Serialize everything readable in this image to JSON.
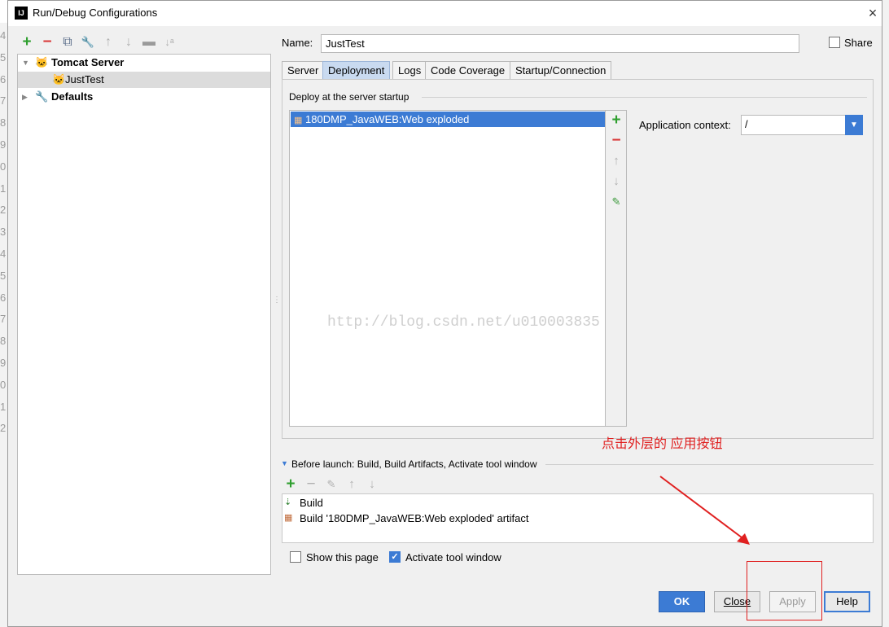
{
  "window": {
    "title": "Run/Debug Configurations",
    "close_glyph": "×"
  },
  "toolbar": {
    "icons": [
      {
        "name": "add-icon",
        "glyph": "+",
        "color": "#2f9f2f"
      },
      {
        "name": "remove-icon",
        "glyph": "−",
        "color": "#d93a3a"
      },
      {
        "name": "copy-icon",
        "glyph": "⧉",
        "color": "#5a6d8a"
      },
      {
        "name": "edit-defaults-icon",
        "glyph": "🔧",
        "color": "#8a6a3a"
      },
      {
        "name": "move-up-icon",
        "glyph": "↑",
        "color": "#b0b0b0"
      },
      {
        "name": "move-down-icon",
        "glyph": "↓",
        "color": "#b0b0b0"
      },
      {
        "name": "folder-icon",
        "glyph": "▬",
        "color": "#9a9a9a"
      },
      {
        "name": "sort-icon",
        "glyph": "↓ᵃ",
        "color": "#b0b0b0"
      }
    ]
  },
  "tree": {
    "items": [
      {
        "label": "Tomcat Server",
        "bold": true,
        "arrow": "▼"
      },
      {
        "label": "JustTest",
        "bold": false,
        "selected": true
      },
      {
        "label": "Defaults",
        "bold": true,
        "arrow": "▶"
      }
    ]
  },
  "form": {
    "name_label": "Name:",
    "name_value": "JustTest",
    "share_label": "Share"
  },
  "tabs": [
    {
      "label": "Server",
      "active": false
    },
    {
      "label": "Deployment",
      "active": true
    },
    {
      "label": "Logs",
      "active": false
    },
    {
      "label": "Code Coverage",
      "active": false
    },
    {
      "label": "Startup/Connection",
      "active": false
    }
  ],
  "deployment": {
    "section_title": "Deploy at the server startup",
    "items": [
      "180DMP_JavaWEB:Web exploded"
    ],
    "app_context_label": "Application context:",
    "app_context_value": "/"
  },
  "watermark": "http://blog.csdn.net/u010003835",
  "annotation": "点击外层的 应用按钮",
  "before_launch": {
    "title": "Before launch: Build, Build Artifacts, Activate tool window",
    "items": [
      "Build",
      "Build '180DMP_JavaWEB:Web exploded' artifact"
    ]
  },
  "options": {
    "show_page_label": "Show this page",
    "show_page_checked": false,
    "activate_label": "Activate tool window",
    "activate_checked": true
  },
  "buttons": {
    "ok": "OK",
    "close": "Close",
    "apply": "Apply",
    "help": "Help"
  },
  "gutter": [
    "4",
    "5",
    "6",
    "7",
    "8",
    "9",
    "0",
    "1",
    "2",
    "3",
    "4",
    "5",
    "6",
    "7",
    "8",
    "9",
    "0",
    "1",
    "2"
  ],
  "colors": {
    "accent": "#3c7bd4",
    "annotation": "#e02020",
    "add_green": "#2f9f2f",
    "remove_red": "#d93a3a"
  }
}
